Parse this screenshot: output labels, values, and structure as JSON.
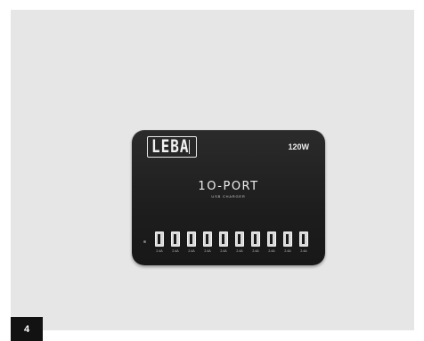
{
  "brand": {
    "logo": "LEBA"
  },
  "charger": {
    "power": "120W",
    "title": "1O-PORT",
    "subtitle": "USB CHARGER",
    "port_labels": [
      "2.4A",
      "2.4A",
      "2.4A",
      "2.4A",
      "2.4A",
      "2.4A",
      "2.4A",
      "2.4A",
      "2.4A",
      "2.4A"
    ]
  },
  "badge": {
    "number": "4"
  },
  "colors": {
    "background": "#e6e6e6",
    "charger_body": "#1d1d1d",
    "badge": "#121212"
  }
}
